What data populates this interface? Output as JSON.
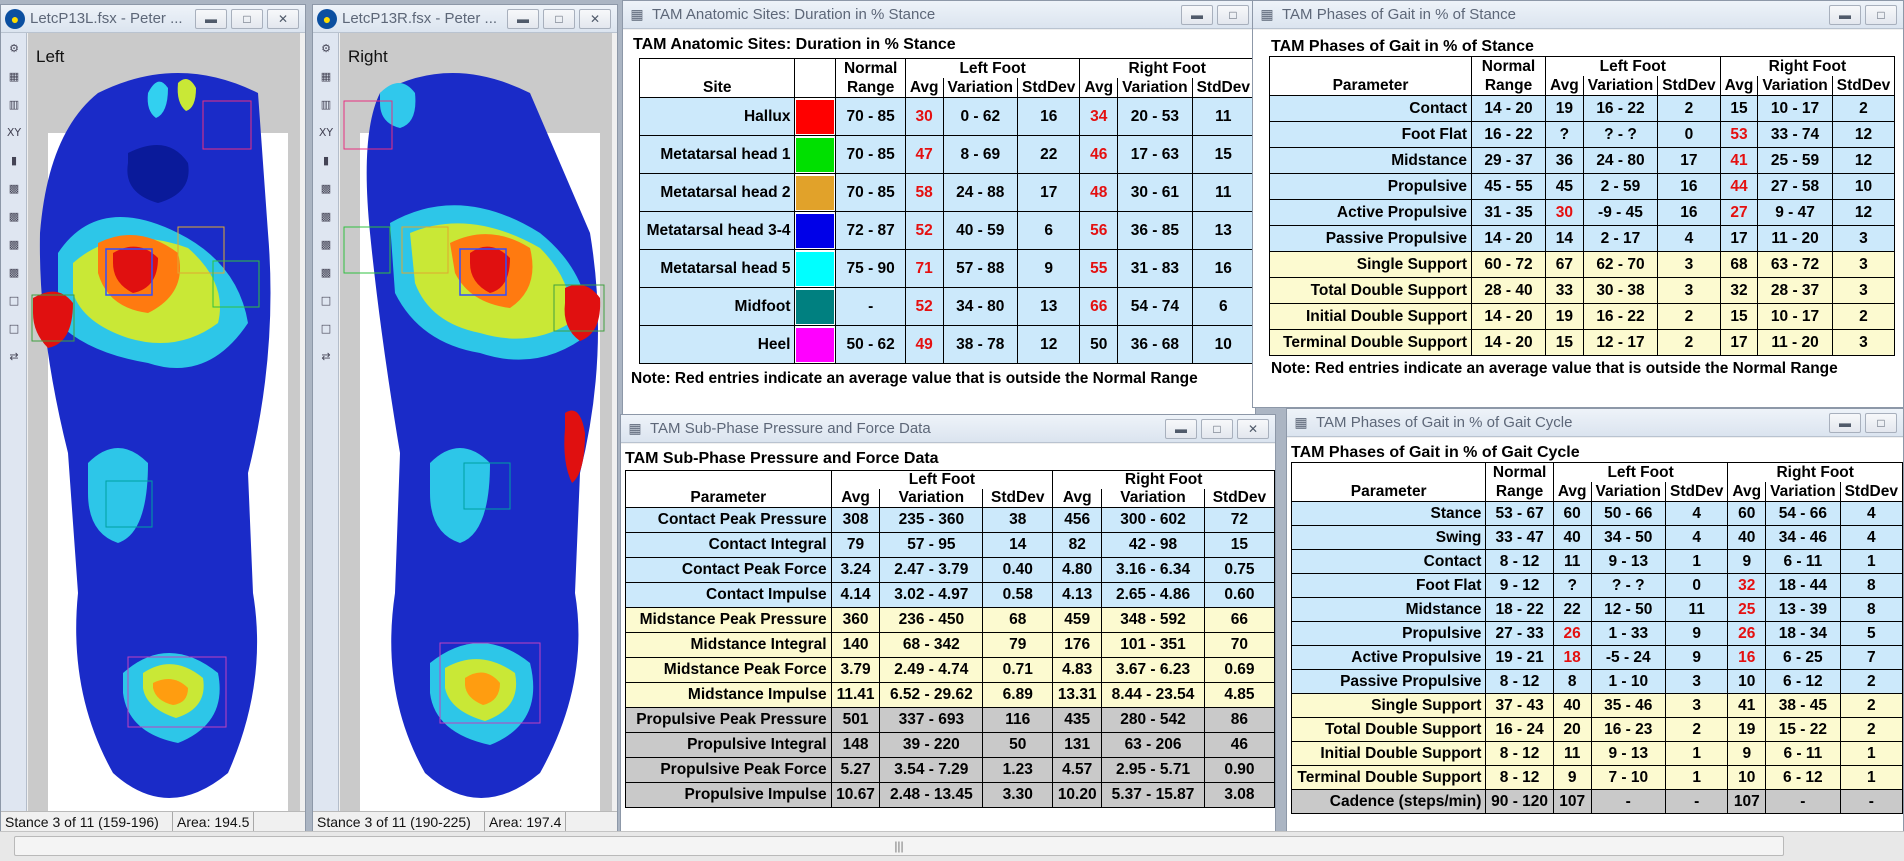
{
  "left_window": {
    "title": "LetcP13L.fsx - Peter ...",
    "label": "Left",
    "status_stance": "Stance 3 of 11 (159-196)",
    "status_area": "Area: 194.5"
  },
  "right_window": {
    "title": "LetcP13R.fsx - Peter ...",
    "label": "Right",
    "status_stance": "Stance 3 of 11 (190-225)",
    "status_area": "Area: 197.4"
  },
  "toolbar": {
    "xy_label": "XY"
  },
  "anatomic": {
    "window_title": "TAM Anatomic Sites: Duration in % Stance",
    "caption": "TAM Anatomic Sites: Duration in % Stance",
    "headers": {
      "site": "Site",
      "normal": "Normal Range",
      "left": "Left Foot",
      "right": "Right Foot",
      "avg": "Avg",
      "variation": "Variation",
      "stddev": "StdDev"
    },
    "rows": [
      {
        "site": "Hallux",
        "color": "#ff0000",
        "normal": "70 - 85",
        "l_avg": "30",
        "l_var": "0 - 62",
        "l_sd": "16",
        "r_avg": "34",
        "r_var": "20 - 53",
        "r_sd": "11",
        "l_red": true,
        "r_red": true
      },
      {
        "site": "Metatarsal head 1",
        "color": "#00e000",
        "normal": "70 - 85",
        "l_avg": "47",
        "l_var": "8 - 69",
        "l_sd": "22",
        "r_avg": "46",
        "r_var": "17 - 63",
        "r_sd": "15",
        "l_red": true,
        "r_red": true
      },
      {
        "site": "Metatarsal head 2",
        "color": "#e1a22a",
        "normal": "70 - 85",
        "l_avg": "58",
        "l_var": "24 - 88",
        "l_sd": "17",
        "r_avg": "48",
        "r_var": "30 - 61",
        "r_sd": "11",
        "l_red": true,
        "r_red": true
      },
      {
        "site": "Metatarsal head 3-4",
        "color": "#0000e8",
        "normal": "72 - 87",
        "l_avg": "52",
        "l_var": "40 - 59",
        "l_sd": "6",
        "r_avg": "56",
        "r_var": "36 - 85",
        "r_sd": "13",
        "l_red": true,
        "r_red": true
      },
      {
        "site": "Metatarsal head 5",
        "color": "#00ffff",
        "normal": "75 - 90",
        "l_avg": "71",
        "l_var": "57 - 88",
        "l_sd": "9",
        "r_avg": "55",
        "r_var": "31 - 83",
        "r_sd": "16",
        "l_red": true,
        "r_red": true
      },
      {
        "site": "Midfoot",
        "color": "#008080",
        "normal": "-",
        "l_avg": "52",
        "l_var": "34 - 80",
        "l_sd": "13",
        "r_avg": "66",
        "r_var": "54 - 74",
        "r_sd": "6",
        "l_red": true,
        "r_red": true
      },
      {
        "site": "Heel",
        "color": "#ff00ff",
        "normal": "50 - 62",
        "l_avg": "49",
        "l_var": "38 - 78",
        "l_sd": "12",
        "r_avg": "50",
        "r_var": "36 - 68",
        "r_sd": "10",
        "l_red": true,
        "r_red": false
      }
    ],
    "note": "Note: Red entries indicate an average value that is outside the Normal Range"
  },
  "phases_stance": {
    "window_title": "TAM Phases of Gait in % of Stance",
    "caption": "TAM Phases of Gait in % of Stance",
    "headers": {
      "param": "Parameter",
      "normal": "Normal Range",
      "left": "Left Foot",
      "right": "Right Foot",
      "avg": "Avg",
      "variation": "Variation",
      "stddev": "StdDev"
    },
    "rows": [
      {
        "p": "Contact",
        "n": "14 - 20",
        "la": "19",
        "lv": "16 - 22",
        "ls": "2",
        "ra": "15",
        "rv": "10 - 17",
        "rs": "2",
        "c": "blue"
      },
      {
        "p": "Foot Flat",
        "n": "16 - 22",
        "la": "?",
        "lv": "? - ?",
        "ls": "0",
        "ra": "53",
        "rv": "33 - 74",
        "rs": "12",
        "c": "blue",
        "rr": true
      },
      {
        "p": "Midstance",
        "n": "29 - 37",
        "la": "36",
        "lv": "24 - 80",
        "ls": "17",
        "ra": "41",
        "rv": "25 - 59",
        "rs": "12",
        "c": "blue",
        "rr": true
      },
      {
        "p": "Propulsive",
        "n": "45 - 55",
        "la": "45",
        "lv": "2 - 59",
        "ls": "16",
        "ra": "44",
        "rv": "27 - 58",
        "rs": "10",
        "c": "blue",
        "rr": true
      },
      {
        "p": "Active Propulsive",
        "n": "31 - 35",
        "la": "30",
        "lv": "-9 - 45",
        "ls": "16",
        "ra": "27",
        "rv": "9 - 47",
        "rs": "12",
        "c": "blue",
        "lr": true,
        "rr": true
      },
      {
        "p": "Passive Propulsive",
        "n": "14 - 20",
        "la": "14",
        "lv": "2 - 17",
        "ls": "4",
        "ra": "17",
        "rv": "11 - 20",
        "rs": "3",
        "c": "blue"
      },
      {
        "p": "Single Support",
        "n": "60 - 72",
        "la": "67",
        "lv": "62 - 70",
        "ls": "3",
        "ra": "68",
        "rv": "63 - 72",
        "rs": "3",
        "c": "yellow"
      },
      {
        "p": "Total Double Support",
        "n": "28 - 40",
        "la": "33",
        "lv": "30 - 38",
        "ls": "3",
        "ra": "32",
        "rv": "28 - 37",
        "rs": "3",
        "c": "yellow"
      },
      {
        "p": "Initial Double Support",
        "n": "14 - 20",
        "la": "19",
        "lv": "16 - 22",
        "ls": "2",
        "ra": "15",
        "rv": "10 - 17",
        "rs": "2",
        "c": "yellow"
      },
      {
        "p": "Terminal Double Support",
        "n": "14 - 20",
        "la": "15",
        "lv": "12 - 17",
        "ls": "2",
        "ra": "17",
        "rv": "11 - 20",
        "rs": "3",
        "c": "yellow"
      }
    ],
    "note": "Note: Red entries indicate an average value that is outside the Normal Range"
  },
  "subphase": {
    "window_title": "TAM Sub-Phase Pressure and Force Data",
    "caption": "TAM Sub-Phase Pressure and Force Data",
    "headers": {
      "param": "Parameter",
      "left": "Left Foot",
      "right": "Right Foot",
      "avg": "Avg",
      "variation": "Variation",
      "stddev": "StdDev"
    },
    "rows": [
      {
        "p": "Contact Peak Pressure",
        "la": "308",
        "lv": "235 - 360",
        "ls": "38",
        "ra": "456",
        "rv": "300 - 602",
        "rs": "72",
        "c": "blue"
      },
      {
        "p": "Contact Integral",
        "la": "79",
        "lv": "57 - 95",
        "ls": "14",
        "ra": "82",
        "rv": "42 - 98",
        "rs": "15",
        "c": "blue"
      },
      {
        "p": "Contact Peak Force",
        "la": "3.24",
        "lv": "2.47 - 3.79",
        "ls": "0.40",
        "ra": "4.80",
        "rv": "3.16 - 6.34",
        "rs": "0.75",
        "c": "blue"
      },
      {
        "p": "Contact Impulse",
        "la": "4.14",
        "lv": "3.02 - 4.97",
        "ls": "0.58",
        "ra": "4.13",
        "rv": "2.65 - 4.86",
        "rs": "0.60",
        "c": "blue"
      },
      {
        "p": "Midstance Peak Pressure",
        "la": "360",
        "lv": "236 - 450",
        "ls": "68",
        "ra": "459",
        "rv": "348 - 592",
        "rs": "66",
        "c": "yellow"
      },
      {
        "p": "Midstance Integral",
        "la": "140",
        "lv": "68 - 342",
        "ls": "79",
        "ra": "176",
        "rv": "101 - 351",
        "rs": "70",
        "c": "yellow"
      },
      {
        "p": "Midstance Peak Force",
        "la": "3.79",
        "lv": "2.49 - 4.74",
        "ls": "0.71",
        "ra": "4.83",
        "rv": "3.67 - 6.23",
        "rs": "0.69",
        "c": "yellow"
      },
      {
        "p": "Midstance Impulse",
        "la": "11.41",
        "lv": "6.52 - 29.62",
        "ls": "6.89",
        "ra": "13.31",
        "rv": "8.44 - 23.54",
        "rs": "4.85",
        "c": "yellow"
      },
      {
        "p": "Propulsive Peak Pressure",
        "la": "501",
        "lv": "337 - 693",
        "ls": "116",
        "ra": "435",
        "rv": "280 - 542",
        "rs": "86",
        "c": "grey"
      },
      {
        "p": "Propulsive Integral",
        "la": "148",
        "lv": "39 - 220",
        "ls": "50",
        "ra": "131",
        "rv": "63 - 206",
        "rs": "46",
        "c": "grey"
      },
      {
        "p": "Propulsive Peak Force",
        "la": "5.27",
        "lv": "3.54 - 7.29",
        "ls": "1.23",
        "ra": "4.57",
        "rv": "2.95 - 5.71",
        "rs": "0.90",
        "c": "grey"
      },
      {
        "p": "Propulsive Impulse",
        "la": "10.67",
        "lv": "2.48 - 13.45",
        "ls": "3.30",
        "ra": "10.20",
        "rv": "5.37 - 15.87",
        "rs": "3.08",
        "c": "grey"
      }
    ]
  },
  "phases_cycle": {
    "window_title": "TAM Phases of Gait in % of Gait Cycle",
    "caption": "TAM Phases of Gait in % of Gait Cycle",
    "headers": {
      "param": "Parameter",
      "normal": "Normal Range",
      "left": "Left Foot",
      "right": "Right Foot",
      "avg": "Avg",
      "variation": "Variation",
      "stddev": "StdDev"
    },
    "rows": [
      {
        "p": "Stance",
        "n": "53 - 67",
        "la": "60",
        "lv": "50 - 66",
        "ls": "4",
        "ra": "60",
        "rv": "54 - 66",
        "rs": "4",
        "c": "blue"
      },
      {
        "p": "Swing",
        "n": "33 - 47",
        "la": "40",
        "lv": "34 - 50",
        "ls": "4",
        "ra": "40",
        "rv": "34 - 46",
        "rs": "4",
        "c": "blue"
      },
      {
        "p": "Contact",
        "n": "8 - 12",
        "la": "11",
        "lv": "9 - 13",
        "ls": "1",
        "ra": "9",
        "rv": "6 - 11",
        "rs": "1",
        "c": "blue"
      },
      {
        "p": "Foot Flat",
        "n": "9 - 12",
        "la": "?",
        "lv": "? - ?",
        "ls": "0",
        "ra": "32",
        "rv": "18 - 44",
        "rs": "8",
        "c": "blue",
        "rr": true
      },
      {
        "p": "Midstance",
        "n": "18 - 22",
        "la": "22",
        "lv": "12 - 50",
        "ls": "11",
        "ra": "25",
        "rv": "13 - 39",
        "rs": "8",
        "c": "blue",
        "rr": true
      },
      {
        "p": "Propulsive",
        "n": "27 - 33",
        "la": "26",
        "lv": "1 - 33",
        "ls": "9",
        "ra": "26",
        "rv": "18 - 34",
        "rs": "5",
        "c": "blue",
        "lr": true,
        "rr": true
      },
      {
        "p": "Active Propulsive",
        "n": "19 - 21",
        "la": "18",
        "lv": "-5 - 24",
        "ls": "9",
        "ra": "16",
        "rv": "6 - 25",
        "rs": "7",
        "c": "blue",
        "lr": true,
        "rr": true
      },
      {
        "p": "Passive Propulsive",
        "n": "8 - 12",
        "la": "8",
        "lv": "1 - 10",
        "ls": "3",
        "ra": "10",
        "rv": "6 - 12",
        "rs": "2",
        "c": "blue"
      },
      {
        "p": "Single Support",
        "n": "37 - 43",
        "la": "40",
        "lv": "35 - 46",
        "ls": "3",
        "ra": "41",
        "rv": "38 - 45",
        "rs": "2",
        "c": "yellow"
      },
      {
        "p": "Total Double Support",
        "n": "16 - 24",
        "la": "20",
        "lv": "16 - 23",
        "ls": "2",
        "ra": "19",
        "rv": "15 - 22",
        "rs": "2",
        "c": "yellow"
      },
      {
        "p": "Initial Double Support",
        "n": "8 - 12",
        "la": "11",
        "lv": "9 - 13",
        "ls": "1",
        "ra": "9",
        "rv": "6 - 11",
        "rs": "1",
        "c": "yellow"
      },
      {
        "p": "Terminal Double Support",
        "n": "8 - 12",
        "la": "9",
        "lv": "7 - 10",
        "ls": "1",
        "ra": "10",
        "rv": "6 - 12",
        "rs": "1",
        "c": "yellow"
      },
      {
        "p": "Cadence (steps/min)",
        "n": "90 - 120",
        "la": "107",
        "lv": "-",
        "ls": "-",
        "ra": "107",
        "rv": "-",
        "rs": "-",
        "c": "grey"
      }
    ]
  },
  "scrollbar": {
    "grip": "|||"
  }
}
